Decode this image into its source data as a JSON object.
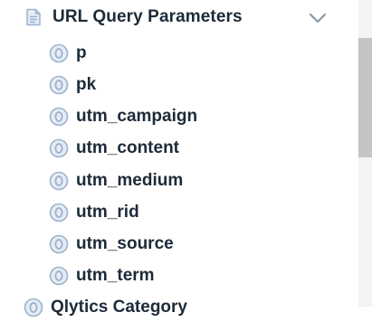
{
  "group": {
    "label": "URL Query Parameters",
    "icon": "document-list-icon",
    "toggle_icon": "chevron-down-icon"
  },
  "items": [
    {
      "label": "p",
      "icon": "circle-o-icon"
    },
    {
      "label": "pk",
      "icon": "circle-o-icon"
    },
    {
      "label": "utm_campaign",
      "icon": "circle-o-icon"
    },
    {
      "label": "utm_content",
      "icon": "circle-o-icon"
    },
    {
      "label": "utm_medium",
      "icon": "circle-o-icon"
    },
    {
      "label": "utm_rid",
      "icon": "circle-o-icon"
    },
    {
      "label": "utm_source",
      "icon": "circle-o-icon"
    },
    {
      "label": "utm_term",
      "icon": "circle-o-icon"
    }
  ],
  "next_group": {
    "label": "Qlytics Category",
    "icon": "circle-o-icon"
  },
  "colors": {
    "text": "#1c2b39",
    "icon_stroke": "#9ab2cc",
    "icon_fill": "#e4ecf5",
    "chevron": "#8a9aaa",
    "scrollbar_thumb": "#c4c4c4",
    "scrollbar_track": "#f3f3f3"
  }
}
